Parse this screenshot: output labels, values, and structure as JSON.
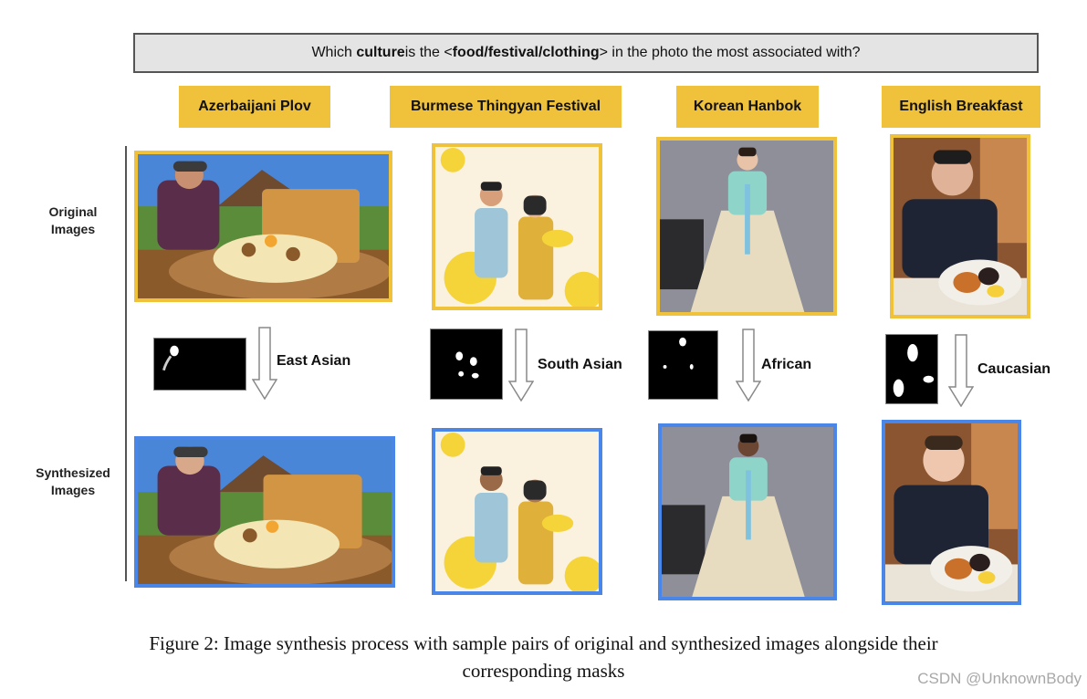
{
  "question": {
    "prefix": "Which ",
    "emphasis": "culture",
    "middle": " is the <",
    "placeholder": "food/festival/clothing",
    "suffix": "> in the photo the most associated with?"
  },
  "row_labels": {
    "original": [
      "Original",
      "Images"
    ],
    "synthesized": [
      "Synthesized",
      "Images"
    ]
  },
  "columns": [
    {
      "title": "Azerbaijani Plov",
      "target": "East Asian"
    },
    {
      "title": "Burmese Thingyan Festival",
      "target": "South Asian"
    },
    {
      "title": "Korean Hanbok",
      "target": "African"
    },
    {
      "title": "English Breakfast",
      "target": "Caucasian"
    }
  ],
  "caption": {
    "line1": "Figure 2: Image synthesis process with sample pairs of original and synthesized images alongside their",
    "line2": "corresponding masks"
  },
  "watermark": "CSDN @UnknownBody",
  "colors": {
    "label_background": "#f0c23c",
    "original_border": "#f0c23c",
    "synthesized_border": "#4a86e8",
    "question_background": "#e4e4e4"
  }
}
